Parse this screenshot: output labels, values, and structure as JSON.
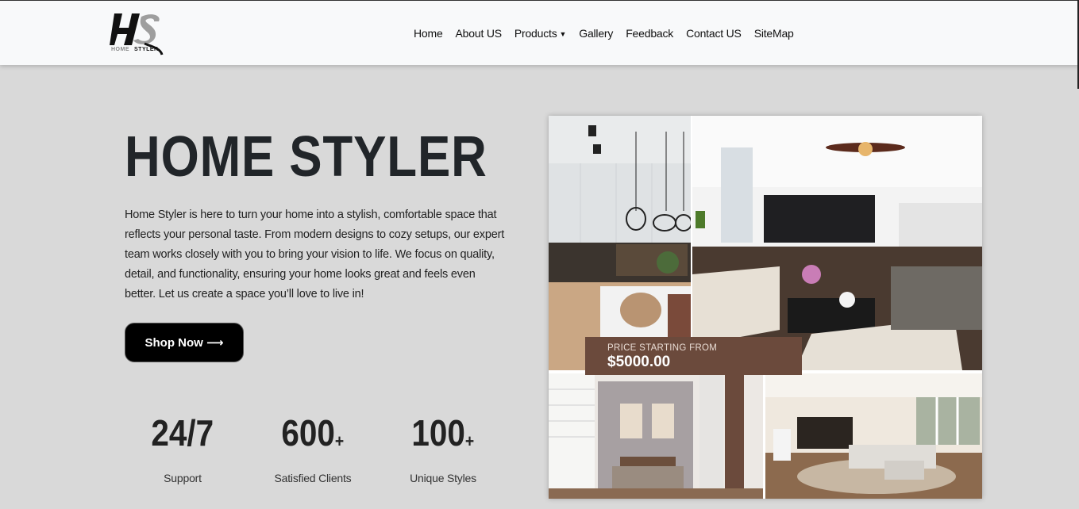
{
  "brand": {
    "logo_mark": "HS",
    "logo_home": "HOME",
    "logo_styler": "STYLER"
  },
  "nav": {
    "items": [
      {
        "label": "Home"
      },
      {
        "label": "About US"
      },
      {
        "label": "Products",
        "dropdown": true
      },
      {
        "label": "Gallery"
      },
      {
        "label": "Feedback"
      },
      {
        "label": "Contact US"
      },
      {
        "label": "SiteMap"
      }
    ]
  },
  "hero": {
    "title": "HOME STYLER",
    "description": "Home Styler is here to turn your home into a stylish, comfortable space that reflects your personal taste. From modern designs to cozy setups, our expert team works closely with you to bring your vision to life. We focus on quality, detail, and functionality, ensuring your home looks great and feels even better. Let us create a space you’ll love to live in!",
    "cta_label": "Shop Now ⟶"
  },
  "stats": [
    {
      "value": "24/7",
      "suffix": "",
      "label": "Support"
    },
    {
      "value": "600",
      "suffix": "+",
      "label": "Satisfied Clients"
    },
    {
      "value": "100",
      "suffix": "+",
      "label": "Unique Styles"
    }
  ],
  "collage": {
    "price_label": "PRICE STARTING FROM",
    "price_value": "$5000.00",
    "images": [
      "kitchen-dining-photo",
      "living-room-photo",
      "bedroom-photo",
      "open-living-room-photo"
    ]
  },
  "colors": {
    "background": "#d9d9d9",
    "navbar": "#f8f9fa",
    "price_box": "#6b4a3c",
    "button": "#000000"
  }
}
